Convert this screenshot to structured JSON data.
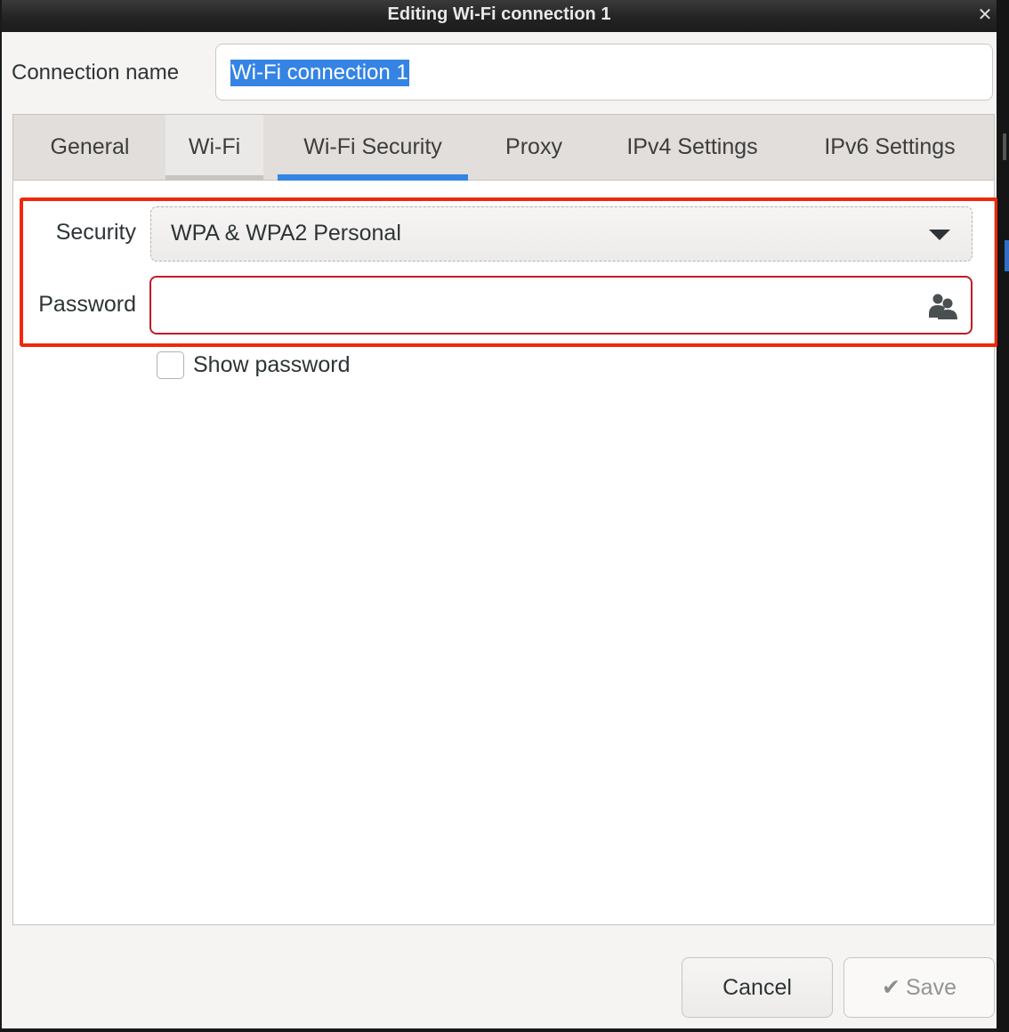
{
  "window": {
    "title": "Editing Wi-Fi connection 1",
    "close_icon": "close-icon"
  },
  "connection": {
    "label": "Connection name",
    "value": "Wi-Fi connection 1"
  },
  "tabs": [
    {
      "label": "General",
      "state": "normal"
    },
    {
      "label": "Wi-Fi",
      "state": "hover"
    },
    {
      "label": "Wi-Fi Security",
      "state": "active"
    },
    {
      "label": "Proxy",
      "state": "normal"
    },
    {
      "label": "IPv4 Settings",
      "state": "normal"
    },
    {
      "label": "IPv6 Settings",
      "state": "normal"
    }
  ],
  "security": {
    "label": "Security",
    "selected": "WPA & WPA2 Personal",
    "dropdown_icon": "chevron-down-icon"
  },
  "password": {
    "label": "Password",
    "value": "",
    "icon": "people-icon"
  },
  "show_password": {
    "label": "Show password",
    "checked": false
  },
  "buttons": {
    "cancel": "Cancel",
    "save": "Save",
    "save_icon": "checkmark-icon"
  },
  "colors": {
    "accent": "#3584e4",
    "error_border": "#c01c28",
    "annotation_highlight": "#f0280a"
  }
}
